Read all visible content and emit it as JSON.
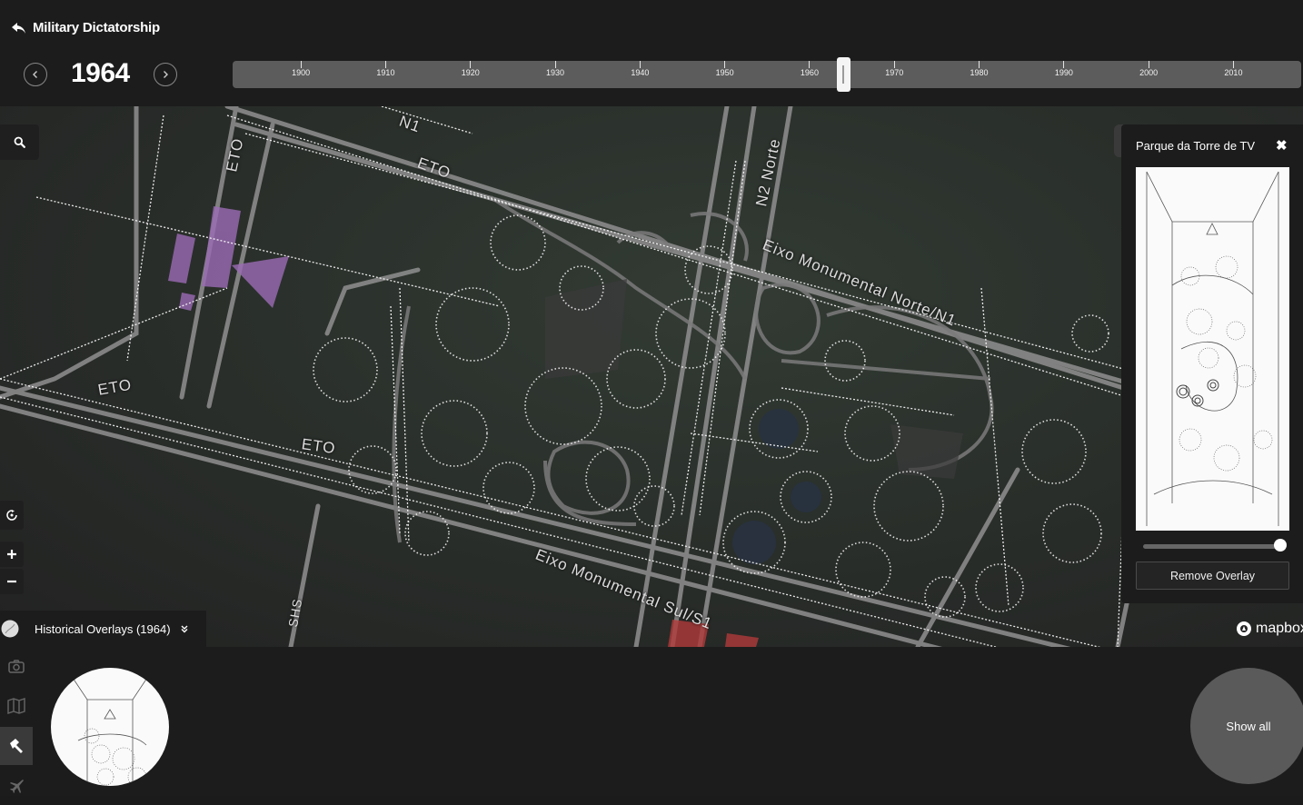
{
  "header": {
    "back_label": "Military Dictatorship",
    "year": "1964"
  },
  "timeline": {
    "labels": [
      "1900",
      "1910",
      "1920",
      "1930",
      "1940",
      "1950",
      "1960",
      "1970",
      "1980",
      "1990",
      "2000",
      "2010"
    ],
    "selected_year": 1964
  },
  "map": {
    "road_labels": [
      "ETO",
      "ETO",
      "ETO",
      "ETO",
      "Eixo Monumental Norte/N1",
      "Eixo Monumental Sul/S1",
      "N2 Norte",
      "SHS",
      "N1"
    ],
    "attribution": "mapbox",
    "colors": {
      "background": "#2b312c",
      "roads": "#8a8a8a",
      "overlay_lines": "#ffffff",
      "purple_building": "#9b6bb5",
      "red_building": "#b03a3a"
    }
  },
  "overlay_panel": {
    "title": "Parque da Torre de TV",
    "close_icon": "close-icon",
    "opacity": 1.0,
    "remove_label": "Remove Overlay"
  },
  "bottom": {
    "overlays_toggle": "Historical Overlays (1964)",
    "show_all": "Show all",
    "side_icons": [
      "camera-icon",
      "map-icon",
      "hammer-icon",
      "plane-icon"
    ]
  }
}
